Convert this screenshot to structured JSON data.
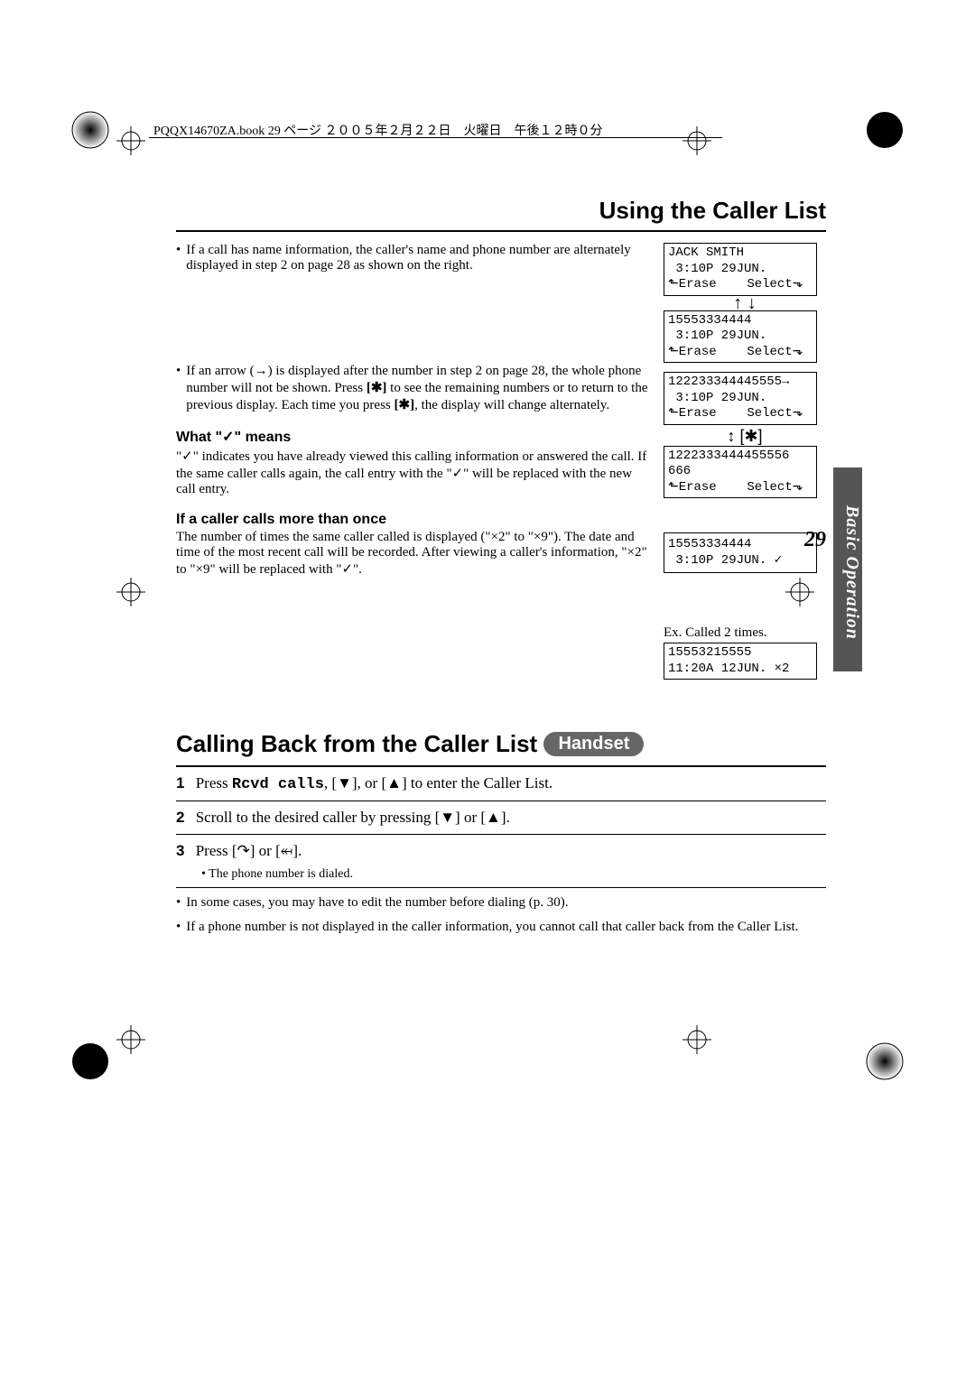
{
  "header_line": "PQQX14670ZA.book  29 ページ  ２００５年２月２２日　火曜日　午後１２時０分",
  "section_tab": "Basic Operation",
  "page_number": "29",
  "section_title": "Using the Caller List",
  "bullets": {
    "b1": "If a call has name information, the caller's name and phone number are alternately displayed in step 2 on page 28 as shown on the right.",
    "b2a": "If an arrow (→) is displayed after the number in step 2 on page 28, the whole phone number will not be shown. Press ",
    "b2b": " to see the remaining numbers or to return to the previous display. Each time you press ",
    "b2c": ", the display will change alternately.",
    "star": "[✱]"
  },
  "subhead1": "What \"✓\" means",
  "para1": "\"✓\" indicates you have already viewed this calling information or answered the call. If the same caller calls again, the call entry with the \"✓\" will be replaced with the new call entry.",
  "subhead2": "If a caller calls more than once",
  "para2": "The number of times the same caller called is displayed (\"×2\" to \"×9\"). The date and time of the most recent call will be recorded. After viewing a caller's information, \"×2\" to \"×9\" will be replaced with \"✓\".",
  "lcd": {
    "box1": "JACK SMITH\n 3:10P 29JUN.\n⬑Erase    Select⬎",
    "box2": "15553334444\n 3:10P 29JUN.\n⬑Erase    Select⬎",
    "box3": "122233344445555→\n 3:10P 29JUN.\n⬑Erase    Select⬎",
    "box4": "1222333444455556\n666\n⬑Erase    Select⬎",
    "box5": "15553334444\n 3:10P 29JUN. ✓",
    "ex_label": "Ex. Called 2 times.",
    "box6": "15553215555\n11:20A 12JUN. ×2"
  },
  "arrows": {
    "updown": "↑\n↓",
    "star_row": "↕ [✱]"
  },
  "section2_title": "Calling Back from the Caller List",
  "badge": "Handset",
  "steps": {
    "s1a": "Press ",
    "s1_mono": "Rcvd calls",
    "s1b": ", [▼], or [▲] to enter the Caller List.",
    "s2": "Scroll to the desired caller by pressing [▼] or [▲].",
    "s3": "Press [↷] or [⬶].",
    "s3_sub": "• The phone number is dialed."
  },
  "notes": {
    "n1": "In some cases, you may have to edit the number before dialing (p. 30).",
    "n2": "If a phone number is not displayed in the caller information, you cannot call that caller back from the Caller List."
  }
}
